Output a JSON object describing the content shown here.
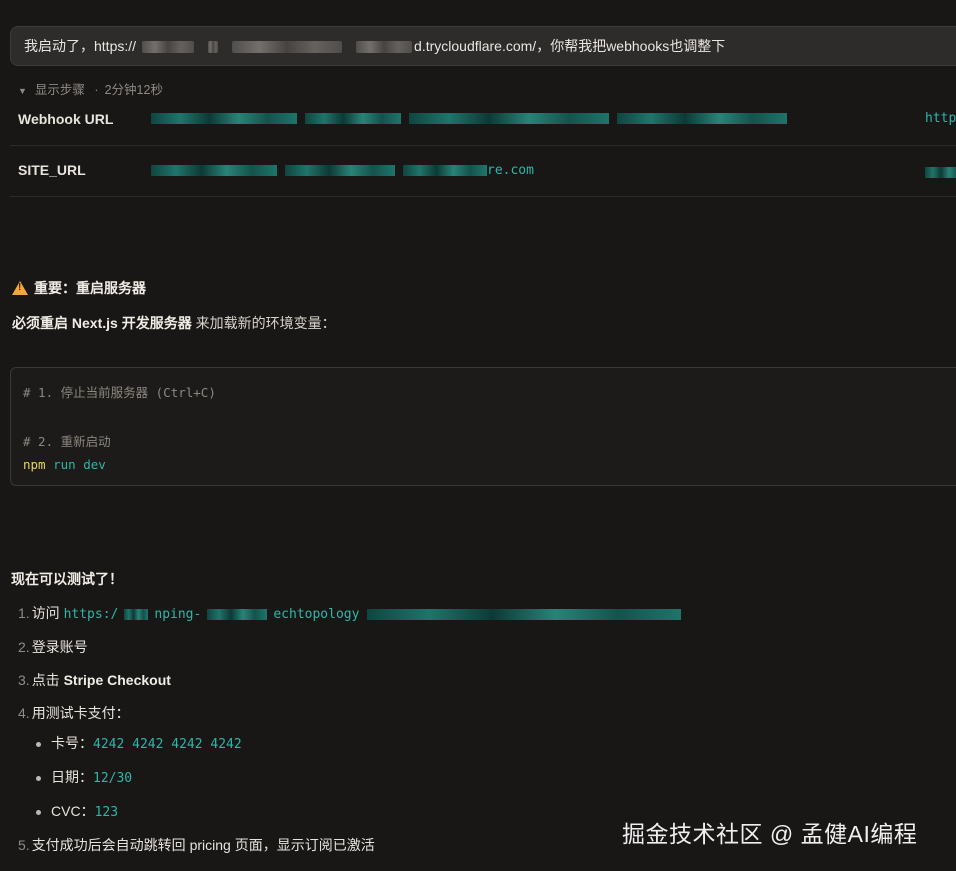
{
  "user_message": {
    "prefix": "我启动了，https://",
    "suffix": "d.trycloudflare.com/，你帮我把webhooks也调整下"
  },
  "steps_toggle": {
    "label": "显示步骤",
    "separator": "·",
    "duration": "2分钟12秒"
  },
  "env_table": [
    {
      "key": "Webhook URL",
      "value_suffix": "",
      "tail": "http"
    },
    {
      "key": "SITE_URL",
      "value_suffix": "re.com",
      "tail": ""
    }
  ],
  "warning": {
    "title": "重要：重启服务器"
  },
  "restart": {
    "bold": "必须重启 Next.js 开发服务器",
    "rest": " 来加载新的环境变量："
  },
  "code": {
    "comment1": "# 1. 停止当前服务器 (Ctrl+C)",
    "comment2": "# 2. 重新启动",
    "cmd": "npm",
    "args": " run dev"
  },
  "test": {
    "title": "现在可以测试了！",
    "items": [
      {
        "num": "1.",
        "text": "访问 ",
        "code": "https:/",
        "code_mid": "nping-",
        "code_mid2": "echtopology"
      },
      {
        "num": "2.",
        "text": "登录账号"
      },
      {
        "num": "3.",
        "text": "点击 ",
        "bold": "Stripe Checkout"
      },
      {
        "num": "4.",
        "text": "用测试卡支付："
      },
      {
        "num": "5.",
        "text": "支付成功后会自动跳转回 pricing 页面，显示订阅已激活"
      }
    ],
    "sub_items": [
      {
        "label": "卡号：",
        "value": "4242 4242 4242 4242"
      },
      {
        "label": "日期：",
        "value": "12/30"
      },
      {
        "label": "CVC：",
        "value": "123"
      }
    ]
  },
  "watermark": "掘金技术社区 @ 孟健AI编程"
}
